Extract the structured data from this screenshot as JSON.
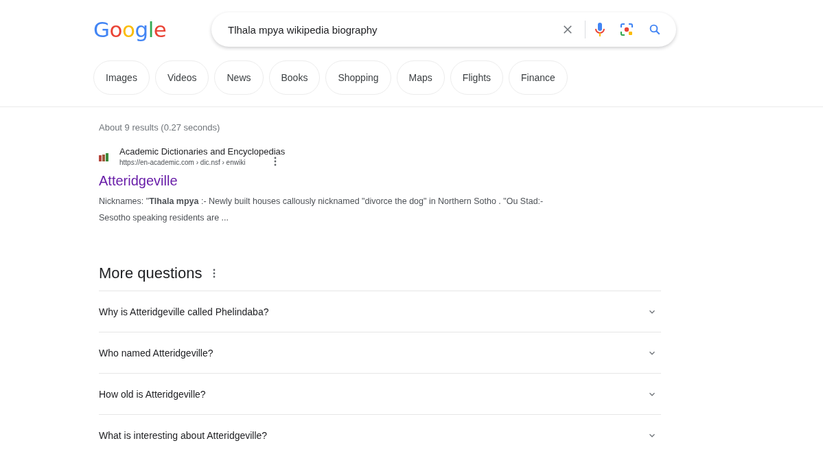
{
  "header": {
    "logo": "Google",
    "search": {
      "value": "Tlhala mpya wikipedia biography"
    }
  },
  "filters": [
    {
      "label": "Images"
    },
    {
      "label": "Videos"
    },
    {
      "label": "News"
    },
    {
      "label": "Books"
    },
    {
      "label": "Shopping"
    },
    {
      "label": "Maps"
    },
    {
      "label": "Flights"
    },
    {
      "label": "Finance"
    }
  ],
  "stats": "About 9 results (0.27 seconds)",
  "results": [
    {
      "site": "Academic Dictionaries and Encyclopedias",
      "url": "https://en-academic.com › dic.nsf › enwiki",
      "title": "Atteridgeville",
      "visited": true,
      "snippet": "Nicknames: \"**Tlhala mpya** :- Newly built houses callously nicknamed \"divorce the dog\" in Northern Sotho . \"Ou Stad:- Sesotho speaking residents are ..."
    }
  ],
  "questions": {
    "heading": "More questions",
    "items": [
      {
        "text": "Why is Atteridgeville called Phelindaba?",
        "expanded": false
      },
      {
        "text": "Who named Atteridgeville?",
        "expanded": false
      },
      {
        "text": "How old is Atteridgeville?",
        "expanded": false
      },
      {
        "text": "What is interesting about Atteridgeville?",
        "expanded": false
      }
    ]
  }
}
